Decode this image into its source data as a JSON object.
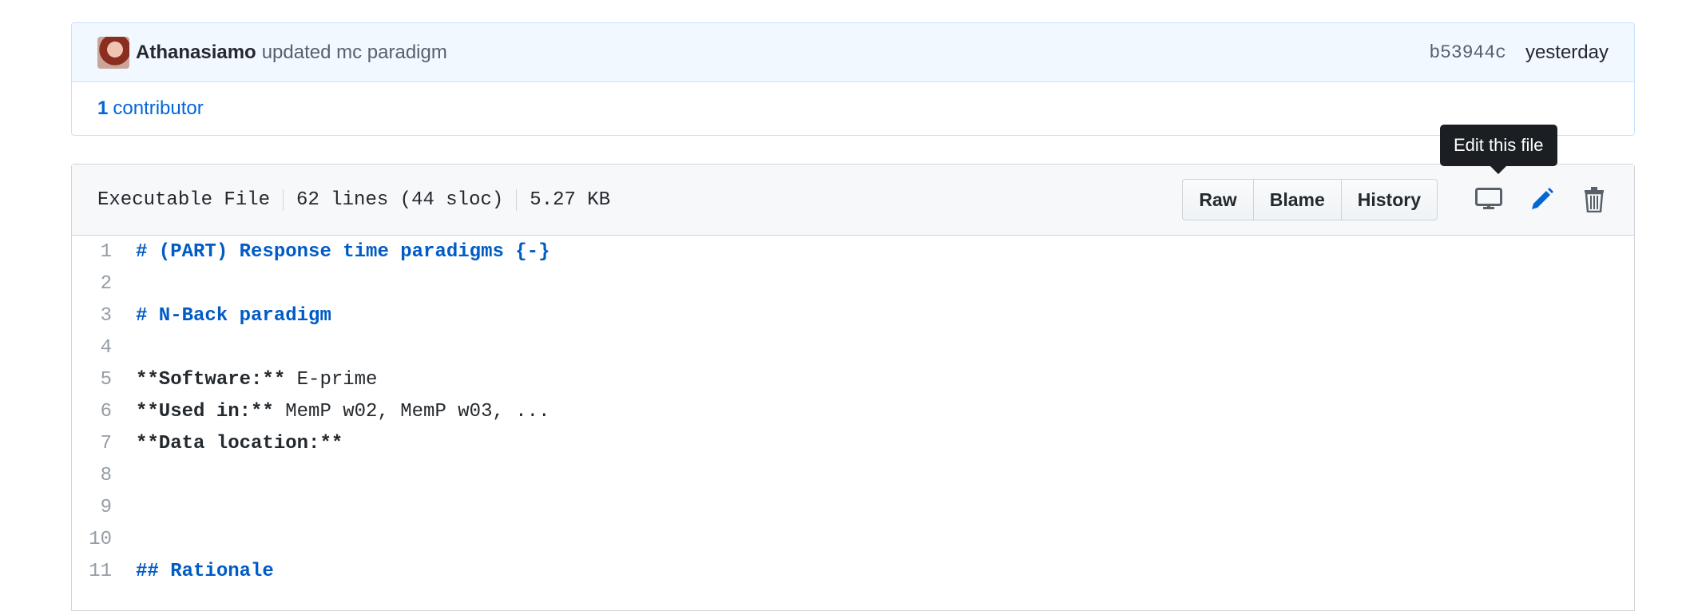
{
  "commit": {
    "author": "Athanasiamo",
    "message": "updated mc paradigm",
    "sha": "b53944c",
    "time": "yesterday"
  },
  "contributors": {
    "count": "1",
    "label": "contributor"
  },
  "file_header": {
    "mode": "Executable File",
    "lines": "62 lines (44 sloc)",
    "size": "5.27 KB",
    "buttons": {
      "raw": "Raw",
      "blame": "Blame",
      "history": "History"
    },
    "icons": [
      "desktop-icon",
      "pencil-icon",
      "trashcan-icon"
    ],
    "tooltip": "Edit this file"
  },
  "code_lines": [
    {
      "n": "1",
      "text": "# (PART) Response time paradigms {-}"
    },
    {
      "n": "2",
      "text": ""
    },
    {
      "n": "3",
      "text": "# N-Back paradigm"
    },
    {
      "n": "4",
      "text": ""
    },
    {
      "n": "5",
      "bold": "**Software:**",
      "rest": " E-prime"
    },
    {
      "n": "6",
      "bold": "**Used in:**",
      "rest": " MemP w02, MemP w03, ..."
    },
    {
      "n": "7",
      "bold": "**Data location:**",
      "rest": ""
    },
    {
      "n": "8",
      "text": ""
    },
    {
      "n": "9",
      "text": ""
    },
    {
      "n": "10",
      "text": ""
    },
    {
      "n": "11",
      "text": "## Rationale"
    }
  ],
  "colors": {
    "link": "#0366d6",
    "heading": "#005cc5",
    "header_bg": "#f1f8ff"
  }
}
